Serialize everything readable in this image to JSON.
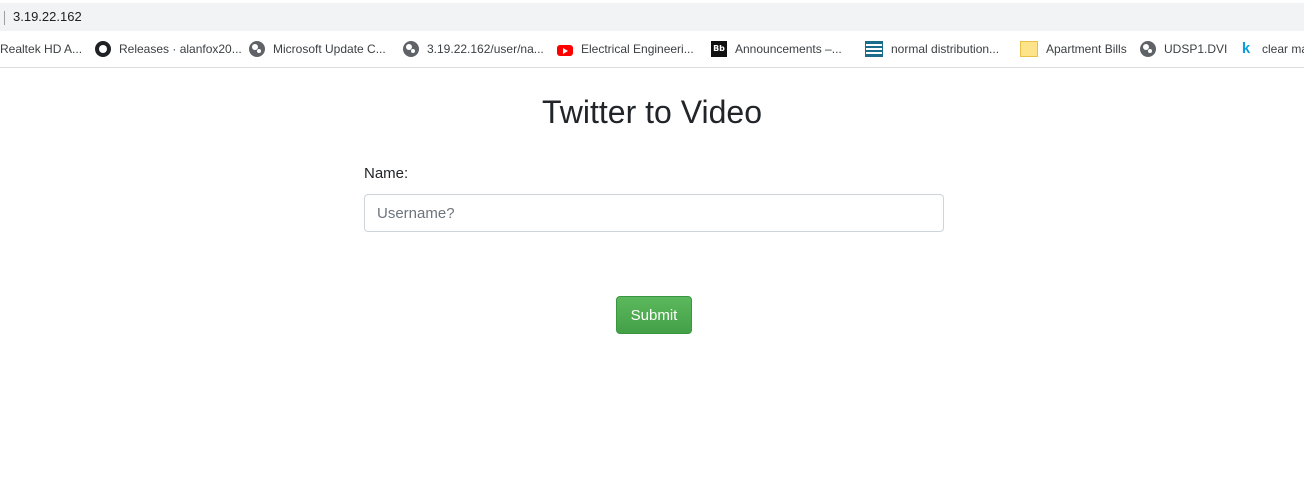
{
  "address_bar": {
    "url": "3.19.22.162"
  },
  "bookmarks": [
    {
      "label": "Realtek HD A...",
      "icon": "none"
    },
    {
      "label": "Releases · alanfox20...",
      "icon": "github-icon"
    },
    {
      "label": "Microsoft Update C...",
      "icon": "globe-icon"
    },
    {
      "label": "3.19.22.162/user/na...",
      "icon": "globe-icon"
    },
    {
      "label": "Electrical Engineeri...",
      "icon": "youtube-icon"
    },
    {
      "label": "Announcements –...",
      "icon": "blackboard-icon"
    },
    {
      "label": "normal distribution...",
      "icon": "stats-icon"
    },
    {
      "label": "Apartment Bills",
      "icon": "folder-icon"
    },
    {
      "label": "UDSP1.DVI",
      "icon": "globe-icon"
    },
    {
      "label": "clear ma",
      "icon": "k-icon"
    }
  ],
  "page": {
    "title": "Twitter to Video",
    "name_label": "Name:",
    "username_placeholder": "Username?",
    "username_value": "",
    "submit_label": "Submit"
  },
  "colors": {
    "submit_button": "#4cae4c",
    "input_border": "#ced4da",
    "address_bar_bg": "#f1f3f4"
  }
}
